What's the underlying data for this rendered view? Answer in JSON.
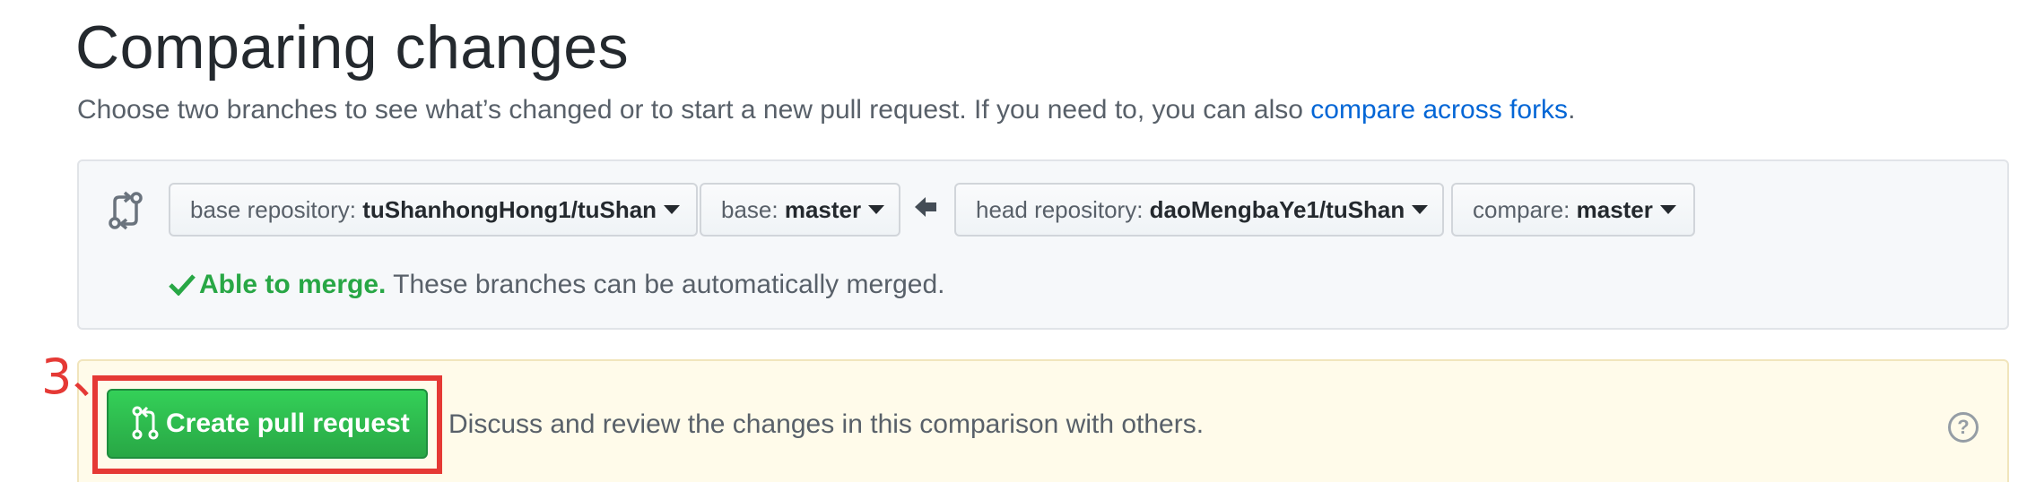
{
  "header": {
    "title": "Comparing changes",
    "subtitle": "Choose two branches to see what’s changed or to start a new pull request. If you need to, you can also ",
    "subtitle_link": "compare across forks",
    "subtitle_end": "."
  },
  "compare": {
    "base_repo_label": "base repository: ",
    "base_repo_value": "tuShanhongHong1/tuShan",
    "base_label": "base: ",
    "base_value": "master",
    "head_repo_label": "head repository: ",
    "head_repo_value": "daoMengbaYe1/tuShan",
    "compare_label": "compare: ",
    "compare_value": "master",
    "merge_ok": "Able to merge.",
    "merge_text": " These branches can be automatically merged."
  },
  "pull_request": {
    "annotation": "3、",
    "button_label": "Create pull request",
    "description": "Discuss and review the changes in this comparison with others.",
    "help_icon": "?"
  },
  "icons": {
    "compare": "git-compare-icon",
    "arrow": "arrow-left-icon",
    "check": "check-icon",
    "pull_request": "git-pull-request-icon",
    "help": "question-circle-icon"
  },
  "colors": {
    "success": "#28a745",
    "link": "#0366d6",
    "annotation": "#e53935",
    "pr_box_bg": "#fffbea"
  }
}
